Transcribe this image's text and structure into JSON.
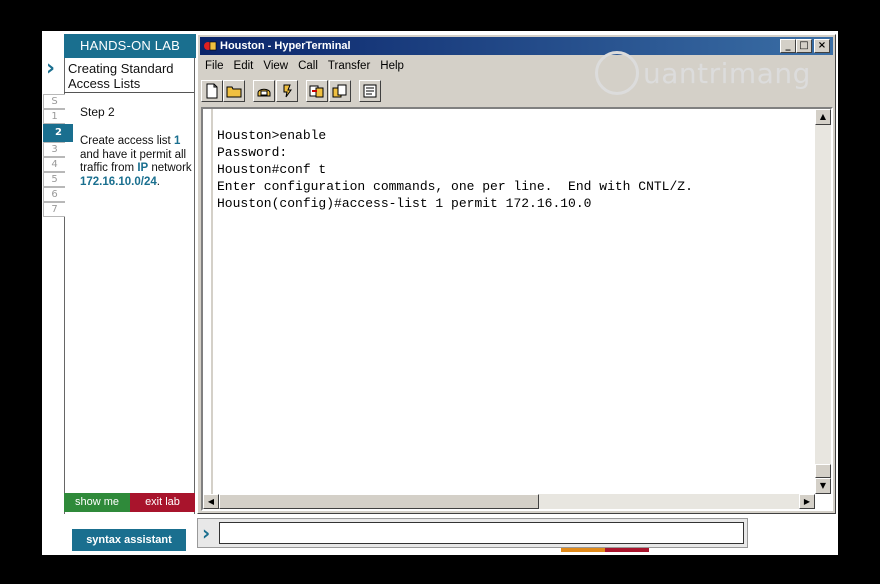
{
  "lab": {
    "header": "HANDS-ON LAB",
    "title": "Creating Standard Access Lists",
    "step_tabs": [
      "S",
      "1",
      "2",
      "3",
      "4",
      "5",
      "6",
      "7"
    ],
    "active_step": "2",
    "step_label": "Step 2",
    "instruction_pre": "Create access list ",
    "instruction_num": "1",
    "instruction_mid": " and have it permit all traffic from ",
    "instruction_ip_word": "IP",
    "instruction_post": " network",
    "instruction_network": "172.16.10.0/24",
    "instruction_end": ".",
    "show_me_label": "show me",
    "exit_lab_label": "exit lab",
    "syntax_assistant_label": "syntax assistant"
  },
  "window": {
    "title": "Houston - HyperTerminal",
    "menu": [
      "File",
      "Edit",
      "View",
      "Call",
      "Transfer",
      "Help"
    ],
    "toolbar_icons": [
      "new-icon",
      "open-icon",
      "call-icon",
      "disconnect-icon",
      "send-icon",
      "receive-icon",
      "properties-icon"
    ]
  },
  "terminal": {
    "lines": [
      "Houston>enable",
      "Password:",
      "Houston#conf t",
      "Enter configuration commands, one per line.  End with CNTL/Z.",
      "Houston(config)#access-list 1 permit 172.16.10.0"
    ]
  },
  "watermark": "uantrimang",
  "command": {
    "value": ""
  },
  "colors": {
    "accent": "#1a6f8f",
    "show_me": "#2f8a3a",
    "exit_lab": "#a8142c",
    "titlebar": "#0a246a"
  }
}
